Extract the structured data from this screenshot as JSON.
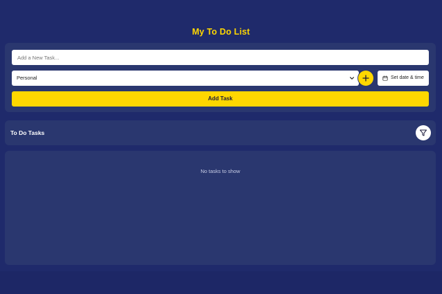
{
  "app": {
    "title": "My To Do List"
  },
  "form": {
    "task_input_value": "",
    "task_input_placeholder": "Add a New Task...",
    "category_selected": "Personal",
    "add_icon": "plus-icon",
    "date_button_label": "Set date & time",
    "date_icon": "calendar-icon",
    "add_task_label": "Add Task"
  },
  "tasks": {
    "header_title": "To Do Tasks",
    "filter_icon": "filter-icon",
    "empty_message": "No tasks to show"
  },
  "colors": {
    "background": "#1f2a6b",
    "card": "#2a376f",
    "accent": "#ffd700",
    "text_light": "#ffffff"
  }
}
